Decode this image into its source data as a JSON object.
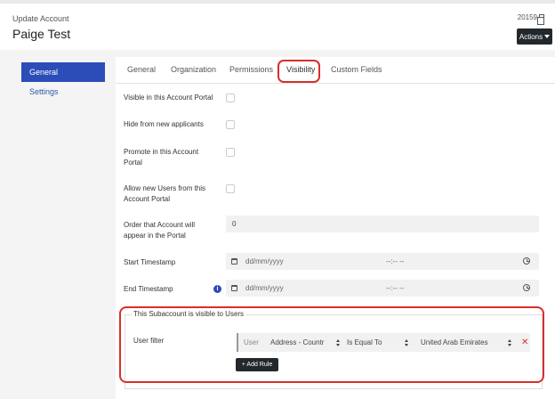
{
  "header": {
    "subtitle": "Update Account",
    "title": "Paige Test",
    "record_id": "20159",
    "actions_label": "Actions"
  },
  "sidebar": {
    "items": [
      {
        "label": "General",
        "active": true
      },
      {
        "label": "Settings",
        "active": false
      }
    ]
  },
  "tabs": [
    {
      "label": "General"
    },
    {
      "label": "Organization"
    },
    {
      "label": "Permissions"
    },
    {
      "label": "Visibility",
      "active": true
    },
    {
      "label": "Custom Fields"
    }
  ],
  "form": {
    "visible_portal_label": "Visible in this Account Portal",
    "hide_new_applicants_label": "Hide from new applicants",
    "promote_label": "Promote in this Account Portal",
    "allow_new_users_label": "Allow new Users from this Account Portal",
    "order_label": "Order that Account will appear in the Portal",
    "order_value": "0",
    "start_label": "Start Timestamp",
    "start_date_placeholder": "dd/mm/yyyy",
    "start_time_placeholder": "--:-- --",
    "end_label": "End Timestamp",
    "end_date_placeholder": "dd/mm/yyyy",
    "end_time_placeholder": "--:-- --"
  },
  "subaccount": {
    "legend": "This Subaccount is visible to Users",
    "filter_label": "User filter",
    "rule": {
      "entity": "User",
      "field": "Address - Countr",
      "operator": "Is Equal To",
      "value": "United Arab Emirates"
    },
    "add_rule_label": "+ Add Rule"
  },
  "colors": {
    "primary": "#2c4db8",
    "dark_button": "#23282d",
    "highlight": "#d7302a"
  }
}
